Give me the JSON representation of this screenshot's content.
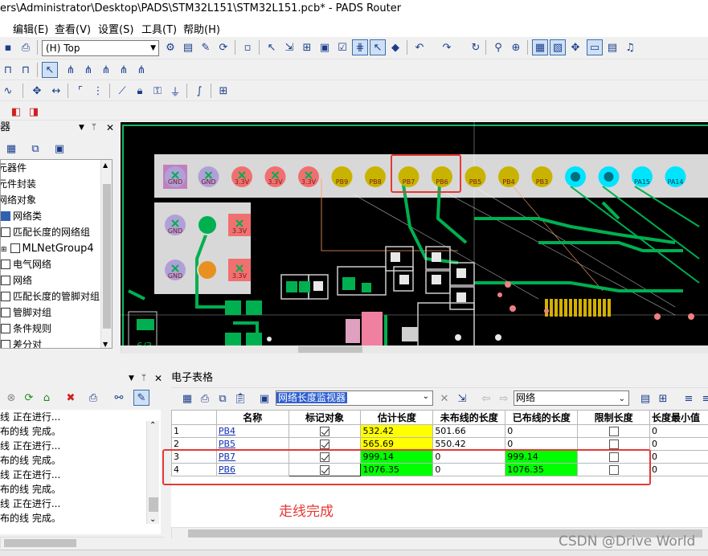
{
  "title": "ers\\Administrator\\Desktop\\PADS\\STM32L151\\STM32L151.pcb* - PADS Router",
  "menu": [
    "编辑(E)",
    "查看(V)",
    "设置(S)",
    "工具(T)",
    "帮助(H)"
  ],
  "layer_select": "(H) Top",
  "left_panel": {
    "header": "器",
    "tree": [
      "元器件",
      "元件封装",
      "网络对象",
      "网络类",
      "匹配长度的网络组",
      "MLNetGroup4",
      "电气网络",
      "网络",
      "匹配长度的管脚对组",
      "管脚对组",
      "条件规则",
      "差分对"
    ]
  },
  "pcb": {
    "pad_labels_top": [
      "GND",
      "GND",
      "3.3V",
      "3.3V",
      "3.3V",
      "PB9",
      "PB8",
      "PB7",
      "PB6",
      "PB5",
      "PB4",
      "PB3",
      "",
      "",
      "PA15",
      "PA14"
    ],
    "pad_labels_left": [
      "GND",
      "3.3V",
      "GND",
      "3.3V"
    ],
    "small_label": "6/3"
  },
  "output": {
    "lines": [
      "线  正在进行...",
      "布的线  完成。",
      "线  正在进行...",
      "布的线  完成。",
      "线  正在进行...",
      "布的线  完成。",
      "线  正在进行...",
      "布的线  完成。"
    ]
  },
  "spreadsheet": {
    "header": "电子表格",
    "monitor_select": "网络长度监视器",
    "type_select": "网络",
    "columns": [
      "",
      "名称",
      "标记对象",
      "估计长度",
      "未布线的长度",
      "已布线的长度",
      "限制长度",
      "长度最小值"
    ],
    "rows": [
      {
        "idx": "1",
        "name": "PB4",
        "marked": true,
        "est": "532.42",
        "unrouted": "501.66",
        "routed": "0",
        "limit": false,
        "min": "0"
      },
      {
        "idx": "2",
        "name": "PB5",
        "marked": true,
        "est": "565.69",
        "unrouted": "550.42",
        "routed": "0",
        "limit": false,
        "min": "0"
      },
      {
        "idx": "3",
        "name": "PB7",
        "marked": true,
        "est": "999.14",
        "unrouted": "0",
        "routed": "999.14",
        "limit": false,
        "min": "0"
      },
      {
        "idx": "4",
        "name": "PB6",
        "marked": true,
        "est": "1076.35",
        "unrouted": "0",
        "routed": "1076.35",
        "limit": false,
        "min": "0"
      }
    ]
  },
  "annotation": "走线完成",
  "watermark": "CSDN @Drive World",
  "colors": {
    "trace": "#00b050",
    "board": "#000000",
    "highlight_red": "#e53935",
    "yellow": "#ffff00",
    "green": "#00ff00",
    "pad_pink": "#f08080",
    "pad_cyan": "#00e5ff"
  }
}
